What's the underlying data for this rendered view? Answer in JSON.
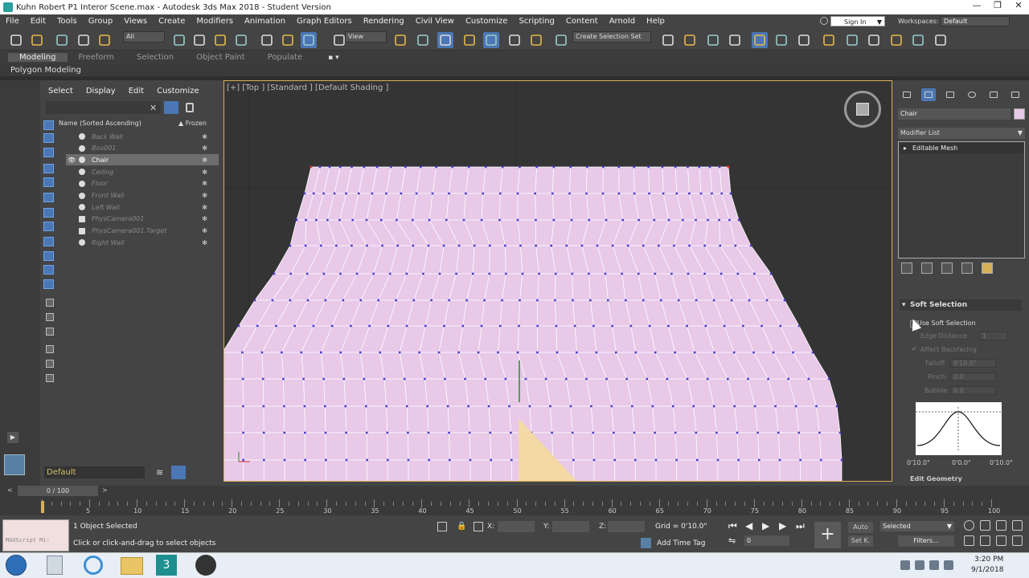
{
  "window": {
    "title": "Kuhn Robert P1 Interor Scene.max - Autodesk 3ds Max 2018 - Student Version"
  },
  "menu": [
    "File",
    "Edit",
    "Tools",
    "Group",
    "Views",
    "Create",
    "Modifiers",
    "Animation",
    "Graph Editors",
    "Rendering",
    "Civil View",
    "Customize",
    "Scripting",
    "Content",
    "Arnold",
    "Help"
  ],
  "account": {
    "sign_in": "Sign In",
    "workspaces_label": "Workspaces:",
    "workspace": "Default"
  },
  "toolbar": {
    "filter": "All",
    "ref_coord": "View",
    "selection_set": "Create Selection Set"
  },
  "ribbon": {
    "tabs": [
      "Modeling",
      "Freeform",
      "Selection",
      "Object Paint",
      "Populate"
    ],
    "subtitle": "Polygon Modeling"
  },
  "scene_explorer": {
    "tabs": [
      "Select",
      "Display",
      "Edit",
      "Customize"
    ],
    "col_name": "Name (Sorted Ascending)",
    "col_frozen": "▲ Frozen",
    "items": [
      "Back Wall",
      "Box001",
      "Chair",
      "Ceiling",
      "Floor",
      "Front Wall",
      "Left Wall",
      "PhysCamera001",
      "PhysCamera001.Target",
      "Right Wall"
    ],
    "selected": "Chair",
    "layer": "Default"
  },
  "viewport": {
    "label": "[+] [Top ] [Standard ] [Default Shading ]"
  },
  "command_panel": {
    "object_name": "Chair",
    "modifier_list": "Modifier List",
    "stack_item": "Editable Mesh",
    "rollout": "Soft Selection",
    "use_soft_selection": "Use Soft Selection",
    "edge_distance": "Edge Distance:",
    "edge_distance_val": "1",
    "affect_backfacing": "Affect Backfacing",
    "falloff": "Falloff:",
    "falloff_val": "0'10.0\"",
    "pinch": "Pinch:",
    "pinch_val": "0.0",
    "bubble": "Bubble:",
    "bubble_val": "0.0",
    "curve_labels": [
      "0'10.0\"",
      "0'0.0\"",
      "0'10.0\""
    ],
    "next_rollout": "Edit Geometry"
  },
  "timeline": {
    "slider": "0 / 100",
    "ticks": [
      "5",
      "10",
      "15",
      "20",
      "25",
      "30",
      "35",
      "40",
      "45",
      "50",
      "55",
      "60",
      "65",
      "70",
      "75",
      "80",
      "85",
      "90",
      "95",
      "100"
    ]
  },
  "status": {
    "maxscript": "MAXScript Mi:",
    "selected": "1 Object Selected",
    "prompt": "Click or click-and-drag to select objects",
    "x": "X:",
    "y": "Y:",
    "z": "Z:",
    "grid": "Grid = 0'10.0\"",
    "add_time_tag": "Add Time Tag",
    "auto": "Auto",
    "setk": "Set K.",
    "selected_dd": "Selected",
    "filters": "Filters...",
    "frame": "0"
  },
  "taskbar": {
    "time": "3:20 PM",
    "date": "9/1/2018"
  }
}
